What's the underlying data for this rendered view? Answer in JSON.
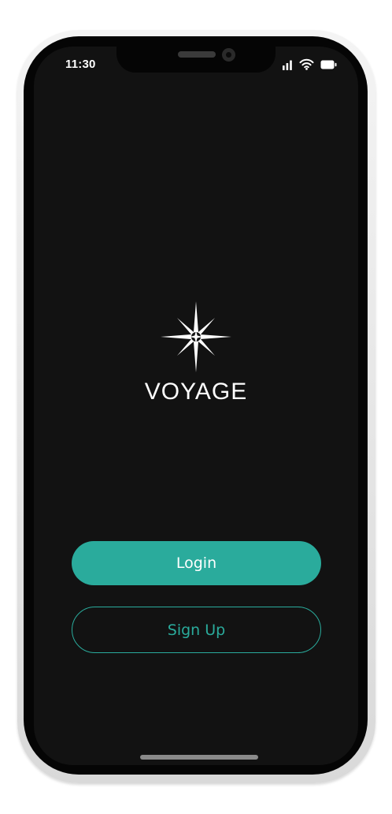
{
  "status_bar": {
    "time": "11:30",
    "icons": [
      "signal-icon",
      "wifi-icon",
      "battery-icon"
    ]
  },
  "brand": {
    "name": "VOYAGE",
    "logo": "compass-star-icon"
  },
  "actions": {
    "login_label": "Login",
    "signup_label": "Sign Up"
  },
  "colors": {
    "accent": "#2aab9c",
    "screen_background": "#121212",
    "text_primary": "#ffffff"
  }
}
